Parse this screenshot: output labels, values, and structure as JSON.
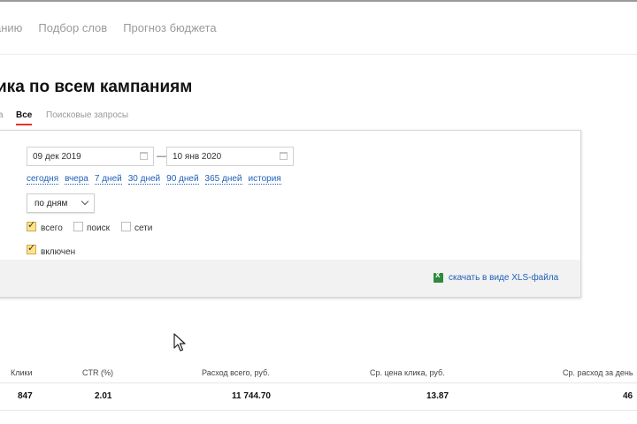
{
  "topnav": {
    "items": [
      "анию",
      "Подбор слов",
      "Прогноз бюджета"
    ]
  },
  "page": {
    "title": "ика по всем кампаниям"
  },
  "tabs": {
    "cut": "а",
    "all": "Все",
    "search_queries": "Поисковые запросы"
  },
  "filters": {
    "date_from": "09 дек 2019",
    "date_to": "10 янв 2020",
    "separator": "—",
    "quick_ranges": [
      "сегодня",
      "вчера",
      "7 дней",
      "30 дней",
      "90 дней",
      "365 дней",
      "история"
    ],
    "grouping": "по дням",
    "checkboxes": [
      {
        "label": "всего",
        "checked": true
      },
      {
        "label": "поиск",
        "checked": false
      },
      {
        "label": "сети",
        "checked": false
      }
    ],
    "enabled": {
      "label": "включен",
      "checked": true
    },
    "download_label": "скачать в виде XLS-файла"
  },
  "table": {
    "headers": [
      "Клики",
      "CTR (%)",
      "Расход всего, руб.",
      "Ср. цена клика, руб.",
      "Ср. расход за день"
    ],
    "values": [
      "847",
      "2.01",
      "11 744.70",
      "13.87",
      "46"
    ]
  },
  "colors": {
    "accent_red": "#e8312f",
    "link_blue": "#1e5fb8",
    "checkbox_yellow": "#ffe38a",
    "excel_green": "#2f8a3b"
  },
  "icons": [
    "calendar-icon",
    "chevron-down-icon",
    "check-icon",
    "excel-icon",
    "mouse-cursor-icon"
  ]
}
